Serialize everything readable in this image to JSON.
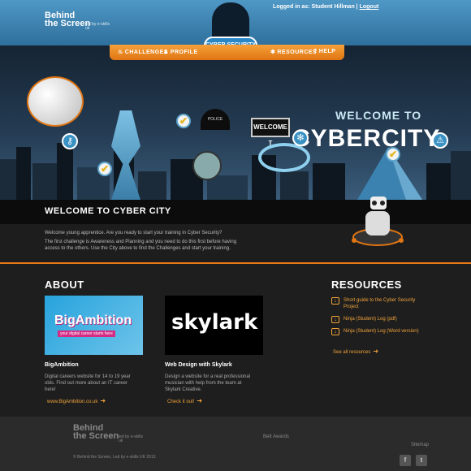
{
  "header": {
    "logo_line1": "Behind",
    "logo_line2": "the Screen",
    "logo_sub": "led by e-skills uk",
    "logged_in_text": "Logged in as: Student Hillman |",
    "logout_label": "Logout"
  },
  "nav": {
    "challenges": "CHALLENGES",
    "profile": "PROFILE",
    "badge": "CYBER SECURITY",
    "resources": "RESOURCES",
    "help": "HELP"
  },
  "hero": {
    "welcome": "WELCOME TO",
    "city": "CYBERCITY",
    "sign": "WELCOME T",
    "police_sign": "POLICE"
  },
  "intro": {
    "title": "WELCOME TO CYBER CITY",
    "p1": "Welcome young apprentice. Are you ready to start your training in Cyber Security?",
    "p2": "The first challenge is Awareness and Planning and you need to do this first before having access to the others. Use the City above to find the Challenges and start your training."
  },
  "about": {
    "title": "ABOUT",
    "card1": {
      "image_title": "BigAmbition",
      "image_tagline": "your digital career starts here",
      "title": "BigAmbition",
      "text": "Digital careers website for 14 to 19 year olds. Find out more about an IT career here!",
      "link": "www.BigAmbition.co.uk"
    },
    "card2": {
      "image_title": "skylark",
      "title": "Web Design with Skylark",
      "text": "Design a website for a real professional musician with help from the team at Skylark Creative.",
      "link": "Check it out!"
    }
  },
  "resources": {
    "title": "RESOURCES",
    "items": [
      "Short guide to the Cyber Security Project",
      "Ninja (Student) Log (pdf)",
      "Ninja (Student) Log (Word version)"
    ],
    "see_all": "See all resources"
  },
  "footer": {
    "logo_line1": "Behind",
    "logo_line2": "the Screen",
    "logo_sub": "led by e-skills uk",
    "copyright": "© Behind the Screen, Led by e-skills UK 2013",
    "awards": "Bett Awards",
    "sitemap": "Sitemap",
    "facebook": "f",
    "twitter": "t"
  },
  "colors": {
    "accent_orange": "#ea7a17",
    "header_blue": "#3f86b7",
    "background": "#1e1e1e"
  }
}
